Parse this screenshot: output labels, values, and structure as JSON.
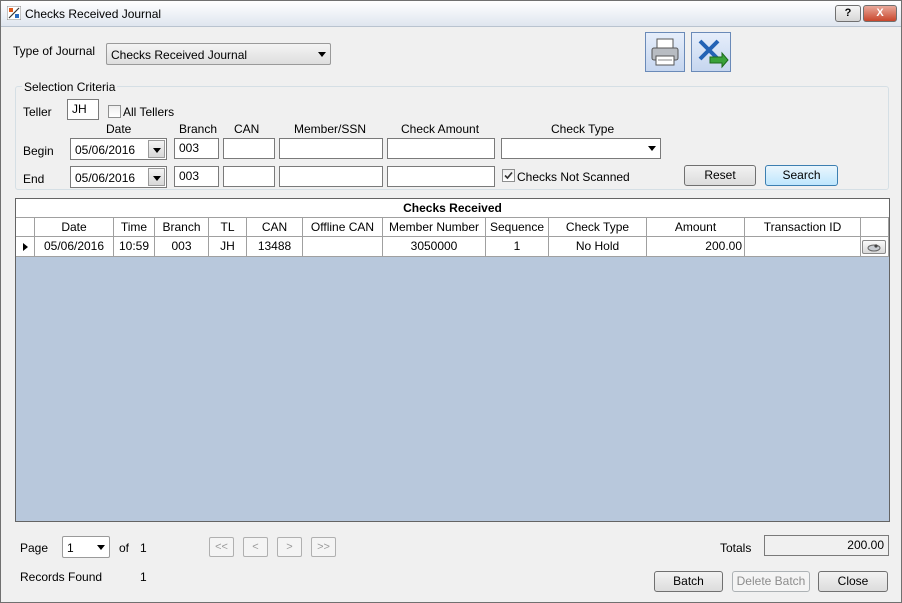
{
  "window": {
    "title": "Checks Received Journal",
    "help_label": "?",
    "close_label": "X"
  },
  "journal": {
    "type_label": "Type of Journal",
    "selected": "Checks Received Journal"
  },
  "toolbar": {
    "print_icon": "printer-icon",
    "export_icon": "excel-export-icon"
  },
  "criteria": {
    "title": "Selection Criteria",
    "teller_label": "Teller",
    "teller_value": "JH",
    "all_tellers_label": "All Tellers",
    "all_tellers_checked": false,
    "headers": {
      "date": "Date",
      "branch": "Branch",
      "can": "CAN",
      "member_ssn": "Member/SSN",
      "check_amount": "Check Amount",
      "check_type": "Check Type"
    },
    "begin": {
      "label": "Begin",
      "date": "05/06/2016",
      "branch": "003",
      "can": "",
      "member_ssn": "",
      "check_amount": ""
    },
    "end": {
      "label": "End",
      "date": "05/06/2016",
      "branch": "003",
      "can": "",
      "member_ssn": "",
      "check_amount": ""
    },
    "check_type_value": "",
    "not_scanned_label": "Checks Not Scanned",
    "not_scanned_checked": true,
    "reset_label": "Reset",
    "search_label": "Search"
  },
  "grid": {
    "caption": "Checks Received",
    "columns": [
      "Date",
      "Time",
      "Branch",
      "TL",
      "CAN",
      "Offline CAN",
      "Member Number",
      "Sequence",
      "Check Type",
      "Amount",
      "Transaction ID"
    ],
    "rows": [
      {
        "date": "05/06/2016",
        "time": "10:59",
        "branch": "003",
        "tl": "JH",
        "can": "13488",
        "offline_can": "",
        "member_number": "3050000",
        "sequence": "1",
        "check_type": "No Hold",
        "amount": "200.00",
        "transaction_id": ""
      }
    ]
  },
  "footer": {
    "page_label": "Page",
    "page_value": "1",
    "of_label": "of",
    "page_total": "1",
    "nav": {
      "first": "<<",
      "prev": "<",
      "next": ">",
      "last": ">>"
    },
    "totals_label": "Totals",
    "totals_value": "200.00",
    "records_label": "Records Found",
    "records_value": "1",
    "batch_label": "Batch",
    "delete_batch_label": "Delete Batch",
    "close_label": "Close"
  }
}
